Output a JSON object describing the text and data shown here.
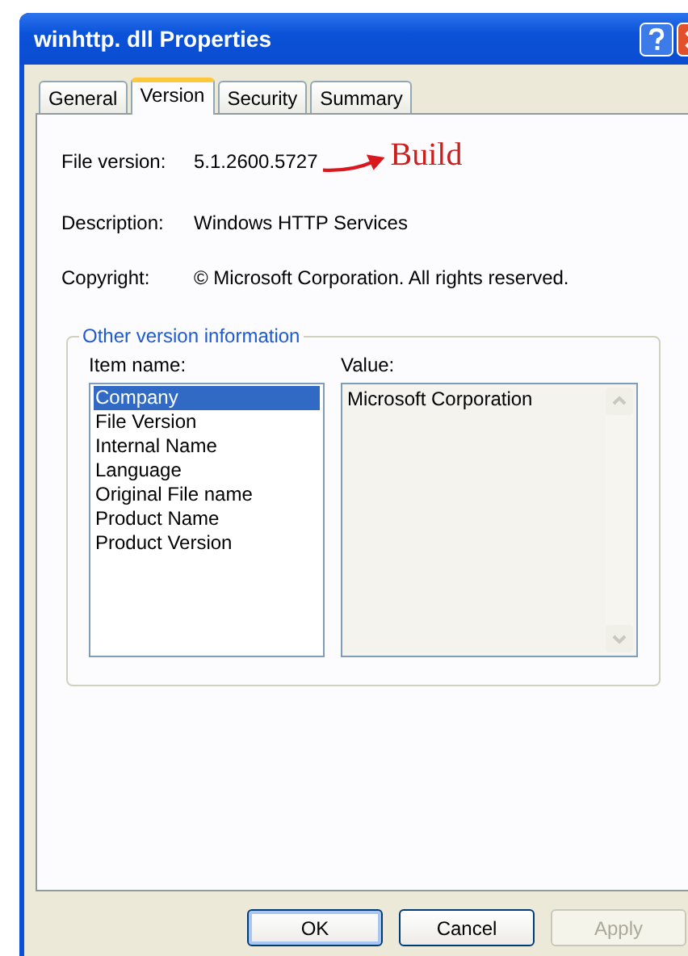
{
  "window": {
    "title": "winhttp. dll Properties"
  },
  "tabs": [
    {
      "label": "General",
      "selected": false
    },
    {
      "label": "Version",
      "selected": true
    },
    {
      "label": "Security",
      "selected": false
    },
    {
      "label": "Summary",
      "selected": false
    }
  ],
  "fields": [
    {
      "label": "File version:",
      "value": "5.1.2600.5727"
    },
    {
      "label": "Description:",
      "value": "Windows HTTP Services"
    },
    {
      "label": "Copyright:",
      "value": "© Microsoft Corporation. All rights reserved."
    }
  ],
  "annotation": {
    "text": "Build"
  },
  "other_version_information": {
    "title": "Other version information",
    "item_header": "Item name:",
    "value_header": "Value:",
    "items": [
      {
        "label": "Company",
        "selected": true
      },
      {
        "label": "File Version",
        "selected": false
      },
      {
        "label": "Internal Name",
        "selected": false
      },
      {
        "label": "Language",
        "selected": false
      },
      {
        "label": "Original File name",
        "selected": false
      },
      {
        "label": "Product Name",
        "selected": false
      },
      {
        "label": "Product Version",
        "selected": false
      }
    ],
    "value": "Microsoft Corporation"
  },
  "buttons": [
    {
      "label": "OK",
      "disabled": false,
      "default": true
    },
    {
      "label": "Cancel",
      "disabled": false,
      "default": false
    },
    {
      "label": "Apply",
      "disabled": true,
      "default": false
    }
  ]
}
